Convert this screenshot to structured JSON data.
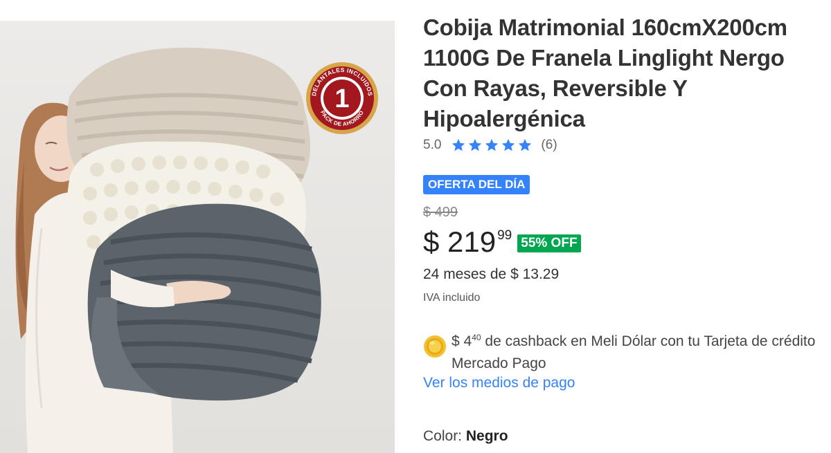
{
  "product": {
    "title": "Cobija Matrimonial 160cmX200cm 1100G De Franela Linglight Nergo Con Rayas, Reversible Y Hipoalergénica",
    "image_badge": {
      "top_text": "DELANTALES INCLUIDOS",
      "number": "1",
      "bottom_text": "PACK DE AHORRO"
    }
  },
  "rating": {
    "value": "5.0",
    "stars": 5,
    "count": "(6)",
    "star_color": "#3483fa"
  },
  "deal": {
    "badge": "OFERTA DEL DÍA",
    "badge_color": "#3483fa"
  },
  "pricing": {
    "original": "$ 499",
    "current_main": "$ 219",
    "current_cents": "99",
    "discount": "55% OFF",
    "discount_color": "#00a650",
    "installments": "24 meses de $ 13.29",
    "tax_note": "IVA incluido"
  },
  "cashback": {
    "icon": "meli-dolar-coin-icon",
    "amount_main": "$ 4",
    "amount_cents": "40",
    "text": "de cashback en Meli Dólar con tu Tarjeta de crédito Mercado Pago"
  },
  "payment": {
    "link": "Ver los medios de pago",
    "link_color": "#3483fa"
  },
  "color": {
    "label": "Color:",
    "value": "Negro"
  }
}
